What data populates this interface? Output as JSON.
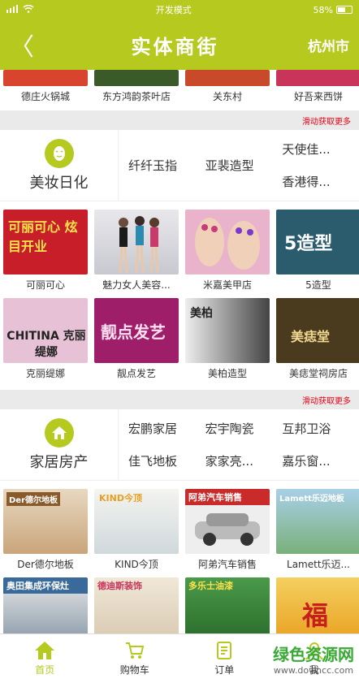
{
  "status": {
    "wifi_label": "wifi",
    "center": "开发模式",
    "battery": "58%",
    "battery_level": 0.58
  },
  "header": {
    "back": "〈",
    "title": "实体商街",
    "city": "杭州市"
  },
  "top_partial": [
    {
      "caption": "德庄火锅城",
      "color": "#d9442e"
    },
    {
      "caption": "东方鸿韵茶叶店",
      "color": "#3a5a2a"
    },
    {
      "caption": "关东村",
      "color": "#c94a2a"
    },
    {
      "caption": "好吾来西饼",
      "color": "#c9345a"
    }
  ],
  "more_label": "滑动获取更多",
  "beauty": {
    "name": "美妆日化",
    "subs": [
      "纤纤玉指",
      "亚裴造型",
      "天使佳...",
      "香港得..."
    ],
    "tiles": [
      {
        "caption": "可丽可心",
        "color": "#c81e2a",
        "ad_text": "可丽可心 炫目开业"
      },
      {
        "caption": "魅力女人美容...",
        "color": "#d8d8dc",
        "ad_text": ""
      },
      {
        "caption": "米嘉美甲店",
        "color": "#e9a9c9",
        "ad_text": ""
      },
      {
        "caption": "5造型",
        "color": "#2a5c6e",
        "ad_text": "5造型"
      },
      {
        "caption": "克丽缇娜",
        "color": "#d8b3c9",
        "ad_text": "CHITINA 克丽缇娜"
      },
      {
        "caption": "靓点发艺",
        "color": "#9e1e6a",
        "ad_text": "靓点发艺"
      },
      {
        "caption": "美柏造型",
        "color": "#5a5a5a",
        "ad_text": "美柏"
      },
      {
        "caption": "美痣堂祠房店",
        "color": "#4a3a1e",
        "ad_text": "美痣堂"
      }
    ]
  },
  "home": {
    "name": "家居房产",
    "subs": [
      "宏鹏家居",
      "宏宇陶瓷",
      "互邦卫浴",
      "佳飞地板",
      "家家亮...",
      "嘉乐窗..."
    ],
    "tiles": [
      {
        "caption": "Der德尔地板",
        "color": "#c9a57a",
        "ad_text": "Der德尔地板"
      },
      {
        "caption": "KIND今顶",
        "color": "#e8ecef",
        "ad_text": "KIND今顶"
      },
      {
        "caption": "阿弟汽车销售",
        "color": "#c92a2a",
        "ad_text": "阿弟汽车销售"
      },
      {
        "caption": "Lamett乐迈...",
        "color": "#7ab07a",
        "ad_text": "Lamett乐迈地板"
      },
      {
        "caption": "",
        "color": "#8a9aa8",
        "ad_text": "奥田集成环保灶"
      },
      {
        "caption": "",
        "color": "#d8c8b0",
        "ad_text": "德迪斯装饰"
      },
      {
        "caption": "",
        "color": "#3a7a3a",
        "ad_text": "多乐士油漆"
      },
      {
        "caption": "",
        "color": "#e9b92a",
        "ad_text": "福"
      }
    ]
  },
  "tabs": [
    {
      "label": "首页",
      "icon": "home-icon",
      "active": true
    },
    {
      "label": "购物车",
      "icon": "cart-icon",
      "active": false
    },
    {
      "label": "订单",
      "icon": "order-icon",
      "active": false
    },
    {
      "label": "我",
      "icon": "user-icon",
      "active": false
    }
  ],
  "watermark": {
    "line1": "绿色资源网",
    "line2": "www.downcc.com"
  },
  "colors": {
    "accent": "#b5c91e",
    "more": "#e60012"
  }
}
